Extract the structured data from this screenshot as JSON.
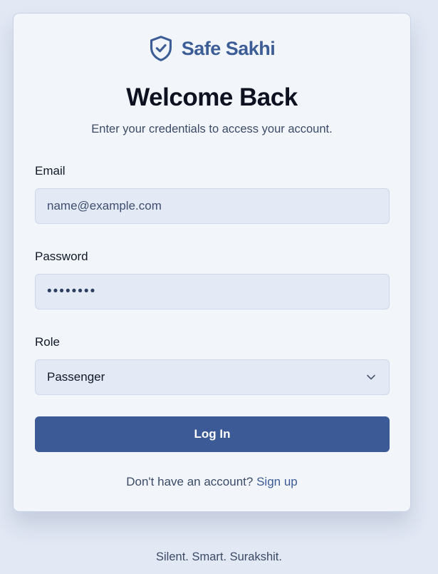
{
  "brand": {
    "name": "Safe Sakhi",
    "icon": "shield-check-icon",
    "color": "#3d5d96"
  },
  "header": {
    "title": "Welcome Back",
    "subtitle": "Enter your credentials to access your account."
  },
  "form": {
    "email": {
      "label": "Email",
      "placeholder": "name@example.com"
    },
    "password": {
      "label": "Password",
      "value": "••••••••"
    },
    "role": {
      "label": "Role",
      "selected": "Passenger"
    },
    "submit_label": "Log In"
  },
  "footer": {
    "signup_prompt": "Don't have an account?",
    "signup_link": "Sign up"
  },
  "tagline": "Silent. Smart. Surakshit.",
  "colors": {
    "accent": "#3b5a96",
    "background": "#e2e8f4",
    "card": "#f2f6fb"
  }
}
